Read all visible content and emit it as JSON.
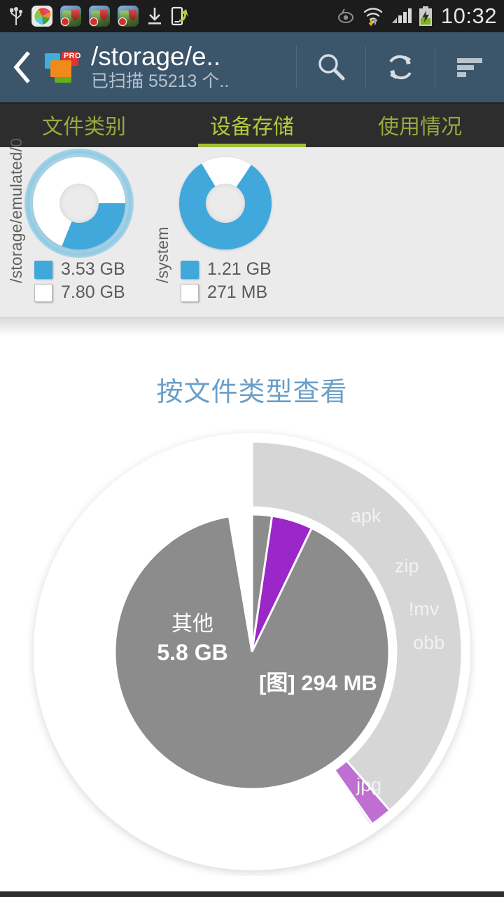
{
  "statusbar": {
    "time": "10:32",
    "icons": [
      "usb-icon",
      "app-icon",
      "game-notification-icon",
      "game-notification-icon",
      "game-notification-icon",
      "download-icon",
      "share-to-phone-icon"
    ],
    "right_icons": [
      "eye-off-icon",
      "wifi-icon",
      "signal-icon",
      "battery-charging-icon"
    ]
  },
  "actionbar": {
    "back_label": "‹",
    "logo_badge": "PRO",
    "title": "/storage/e..",
    "subtitle": "已扫描 55213 个..",
    "buttons": [
      "search-icon",
      "refresh-icon",
      "sort-icon"
    ]
  },
  "tabs": [
    {
      "label": "文件类别",
      "active": false
    },
    {
      "label": "设备存储",
      "active": true
    },
    {
      "label": "使用情况",
      "active": false
    }
  ],
  "colors": {
    "accent_green": "#a2c037",
    "actionbar": "#3b556b",
    "donut_used": "#41a8dc",
    "donut_free": "#ffffff",
    "title_blue": "#6b9fc8",
    "inner_other": "#8c8c8c",
    "ring_gray": "#d6d6d6",
    "purple_image": "#9c27c8",
    "jpg_light": "#d7a9e0",
    "jpg_medium": "#bf6fd1",
    "green_bright": "#9ccb27",
    "green_dark": "#5b8f10"
  },
  "storage": {
    "volumes": [
      {
        "name": "/storage/emulated/0",
        "used_label": "3.53 GB",
        "free_label": "7.80 GB",
        "used_pct": 31,
        "highlighted": true
      },
      {
        "name": "/system",
        "used_label": "1.21 GB",
        "free_label": "271 MB",
        "used_pct": 82,
        "highlighted": false
      }
    ]
  },
  "file_type_section": {
    "title": "按文件类型查看"
  },
  "chart_data": {
    "type": "pie",
    "title": "按文件类型查看",
    "subtitle": "Sunburst: inner ring = category, outer ring = file extension",
    "inner_ring": [
      {
        "label": "其他",
        "size_label": "5.8 GB",
        "value": 5939,
        "color": "#8c8c8c",
        "start_deg": 90,
        "sweep_deg": 350.4
      },
      {
        "label": "",
        "size_label": "",
        "value": 20,
        "color": "#5b8f10",
        "start_deg": 80.4,
        "sweep_deg": 1.2
      },
      {
        "label": "[图]",
        "size_label": "294 MB",
        "value": 294,
        "color": "#9c27c8",
        "start_deg": 81.6,
        "sweep_deg": 17.4
      }
    ],
    "outer_ring": [
      {
        "label": "",
        "ext": "",
        "color": "#d6d6d6",
        "start_deg": 90,
        "sweep_deg": 28
      },
      {
        "label": "apk",
        "ext": "apk",
        "color": "#d6d6d6",
        "start_deg": 62,
        "sweep_deg": 24
      },
      {
        "label": "zip",
        "ext": "zip",
        "color": "#d6d6d6",
        "start_deg": 38,
        "sweep_deg": 18
      },
      {
        "label": "!mv",
        "ext": "!mv",
        "color": "#d6d6d6",
        "start_deg": 20,
        "sweep_deg": 12
      },
      {
        "label": "obb",
        "ext": "obb",
        "color": "#d6d6d6",
        "start_deg": 8,
        "sweep_deg": 10
      },
      {
        "label": "",
        "ext": "",
        "color": "#d6d6d6",
        "start_deg": -2,
        "sweep_deg": 6
      },
      {
        "label": "",
        "ext": "",
        "color": "#d6d6d6",
        "start_deg": -8,
        "sweep_deg": 5
      },
      {
        "label": "",
        "ext": "",
        "color": "#d6d6d6",
        "start_deg": -13,
        "sweep_deg": 3.5
      },
      {
        "label": "",
        "ext": "",
        "color": "#d6d6d6",
        "start_deg": -16.5,
        "sweep_deg": 2.2
      },
      {
        "label": "",
        "ext": "",
        "color": "#d6d6d6",
        "start_deg": -18.7,
        "sweep_deg": 1.6
      },
      {
        "label": "",
        "ext": "",
        "color": "#d6d6d6",
        "start_deg": -20.3,
        "sweep_deg": 1.2
      },
      {
        "label": "",
        "ext": "",
        "color": "#d6d6d6",
        "start_deg": -21.5,
        "sweep_deg": 1.0
      },
      {
        "label": "",
        "ext": "",
        "color": "#d6d6d6",
        "start_deg": -22.5,
        "sweep_deg": 0.8
      },
      {
        "label": "",
        "ext": "",
        "color": "#d6d6d6",
        "start_deg": -23.3,
        "sweep_deg": 0.7
      },
      {
        "label": "",
        "ext": "",
        "color": "#d6d6d6",
        "start_deg": -24.0,
        "sweep_deg": 0.6
      },
      {
        "label": "",
        "ext": "",
        "color": "#d6d6d6",
        "start_deg": -24.6,
        "sweep_deg": 0.5
      },
      {
        "label": "",
        "ext": "",
        "color": "#9ccb27",
        "start_deg": -26.6,
        "sweep_deg": 3.4
      },
      {
        "label": "jpg",
        "ext": "jpg",
        "color": "#d7a9e0",
        "start_deg": -41.5,
        "sweep_deg": 14.3
      },
      {
        "label": "",
        "ext": "",
        "color": "#bf6fd1",
        "start_deg": -48.5,
        "sweep_deg": 6.6
      },
      {
        "label": "",
        "ext": "",
        "color": "#d6d6d6",
        "start_deg": 90,
        "sweep_deg": -139
      }
    ],
    "center_text": {
      "name": "其他",
      "size": "5.8 GB"
    },
    "callout": {
      "name": "[图]",
      "size": "294 MB"
    },
    "legend": "none",
    "grid": false
  }
}
